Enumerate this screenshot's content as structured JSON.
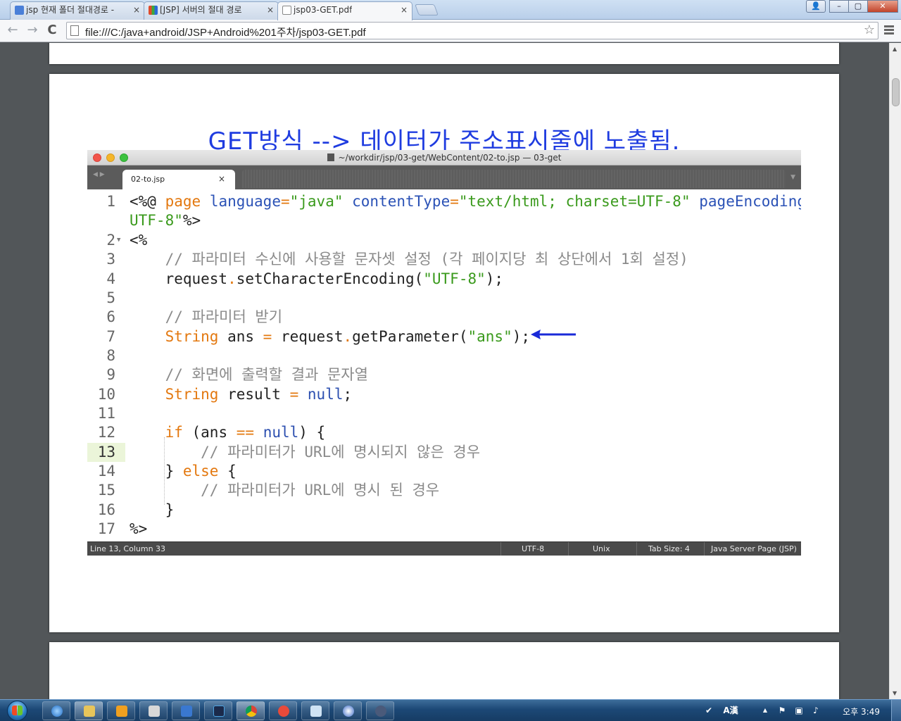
{
  "browser": {
    "tabs": [
      {
        "label": "jsp 현재 폴더 절대경로 -",
        "close": "×",
        "favicon_color": "#4a7fd8"
      },
      {
        "label": "[JSP] 서버의 절대 경로",
        "close": "×",
        "favicon_color": "#d8a43a"
      },
      {
        "label": "jsp03-GET.pdf",
        "close": "×",
        "favicon_color": "#ffffff"
      }
    ],
    "window_controls": {
      "user": "👤",
      "minimize": "–",
      "maximize": "▢",
      "close": "✕"
    },
    "nav": {
      "back": "←",
      "forward": "→",
      "reload": "C"
    },
    "address": {
      "url": "file:///C:/java+android/JSP+Android%201주차/jsp03-GET.pdf",
      "star": "☆"
    }
  },
  "slide": {
    "title": "GET방식 --> 데이터가 주소표시줄에 노출됨."
  },
  "editor": {
    "window_title": "~/workdir/jsp/03-get/WebContent/02-to.jsp — 03-get",
    "tab_name": "02-to.jsp",
    "tab_close": "×",
    "arrows": "◀ ▶",
    "dropdown": "▼",
    "code": {
      "l1": {
        "num": "1",
        "p1": "<%@ ",
        "p2": "page",
        "p3": " ",
        "p4": "language",
        "p5": "=",
        "p6": "\"java\"",
        "p7": " ",
        "p8": "contentType",
        "p9": "=",
        "p10": "\"text/html; charset=UTF-8\"",
        "p11": " ",
        "p12": "pageEncoding",
        "p13": "=\""
      },
      "l1b": {
        "p1": "UTF-8\"",
        "p2": "%>"
      },
      "l2": {
        "num": "2",
        "fold": "▼",
        "text": "<%"
      },
      "l3": {
        "num": "3",
        "text": "    // 파라미터 수신에 사용할 문자셋 설정 (각 페이지당 최 상단에서 1회 설정)"
      },
      "l4": {
        "num": "4",
        "p1": "    request",
        "p2": ".",
        "p3": "setCharacterEncoding(",
        "p4": "\"UTF-8\"",
        "p5": ");"
      },
      "l5": {
        "num": "5"
      },
      "l6": {
        "num": "6",
        "text": "    // 파라미터 받기"
      },
      "l7": {
        "num": "7",
        "p1": "    ",
        "p2": "String",
        "p3": " ans ",
        "p4": "=",
        "p5": " request",
        "p6": ".",
        "p7": "getParameter(",
        "p8": "\"ans\"",
        "p9": ");"
      },
      "l8": {
        "num": "8"
      },
      "l9": {
        "num": "9",
        "text": "    // 화면에 출력할 결과 문자열"
      },
      "l10": {
        "num": "10",
        "p1": "    ",
        "p2": "String",
        "p3": " result ",
        "p4": "=",
        "p5": " ",
        "p6": "null",
        "p7": ";"
      },
      "l11": {
        "num": "11"
      },
      "l12": {
        "num": "12",
        "p1": "    ",
        "p2": "if",
        "p3": " (ans ",
        "p4": "==",
        "p5": " ",
        "p6": "null",
        "p7": ") {"
      },
      "l13": {
        "num": "13",
        "text": "        // 파라미터가 URL에 명시되지 않은 경우"
      },
      "l14": {
        "num": "14",
        "p1": "    } ",
        "p2": "else",
        "p3": " {"
      },
      "l15": {
        "num": "15",
        "text": "        // 파라미터가 URL에 명시 된 경우"
      },
      "l16": {
        "num": "16",
        "text": "    }"
      },
      "l17": {
        "num": "17",
        "text": "%>"
      }
    },
    "status": {
      "position": "Line 13, Column 33",
      "encoding": "UTF-8",
      "line_endings": "Unix",
      "tab_size": "Tab Size: 4",
      "syntax": "Java Server Page (JSP)"
    }
  },
  "taskbar": {
    "clock": "오후 3:49",
    "ime": "A漢",
    "tray_up": "▲"
  },
  "colors": {
    "title_blue": "#1f3ce0",
    "keyword": "#e3780f",
    "string": "#3a9a1c",
    "attribute": "#2b52b6",
    "comment": "#8a8a8a",
    "annotation_arrow": "#1a2ad8"
  }
}
